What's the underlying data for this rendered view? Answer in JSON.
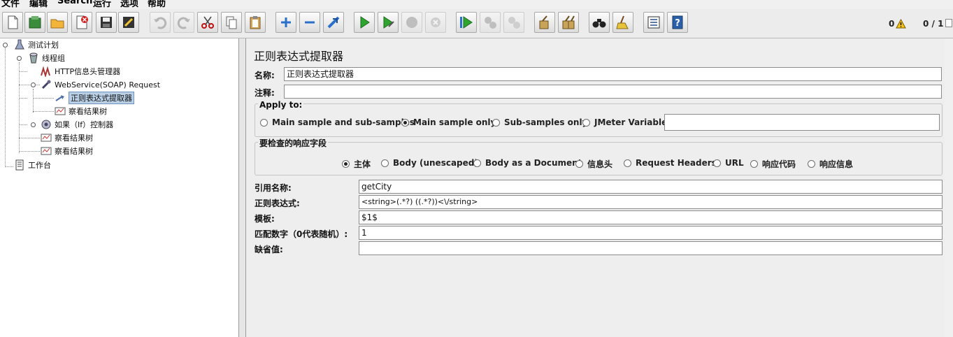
{
  "menu": [
    "文件",
    "编辑",
    "Search",
    "运行",
    "选项",
    "帮助"
  ],
  "status": {
    "warnings": "0",
    "threads": "0 / 1"
  },
  "toolbar": {
    "buttons": [
      "new-file-icon",
      "templates-icon",
      "open-icon",
      "close-icon",
      "save-icon",
      "save-as-icon",
      "undo-icon",
      "redo-icon",
      "cut-icon",
      "copy-icon",
      "paste-icon",
      "expand-icon",
      "collapse-icon",
      "toggle-icon",
      "start-icon",
      "start-no-pause-icon",
      "stop-icon",
      "shutdown-icon",
      "remote-start-icon",
      "remote-stop-icon",
      "remote-shutdown-icon",
      "clear-icon",
      "clear-all-icon",
      "search-icon",
      "reset-search-icon",
      "function-helper-icon",
      "help-icon"
    ]
  },
  "tree": {
    "items": [
      {
        "label": "测试计划"
      },
      {
        "label": "线程组"
      },
      {
        "label": "HTTP信息头管理器"
      },
      {
        "label": "WebService(SOAP) Request"
      },
      {
        "label": "正则表达式提取器"
      },
      {
        "label": "察看结果树"
      },
      {
        "label": "如果（If）控制器"
      },
      {
        "label": "察看结果树"
      },
      {
        "label": "察看结果树"
      },
      {
        "label": "工作台"
      }
    ]
  },
  "panel": {
    "title": "正则表达式提取器",
    "name_label": "名称:",
    "name_value": "正则表达式提取器",
    "comment_label": "注释:",
    "comment_value": "",
    "apply_to": {
      "title": "Apply to:",
      "options": [
        "Main sample and sub-samples",
        "Main sample only",
        "Sub-samples only",
        "JMeter Variable"
      ],
      "selected": 1,
      "variable_value": ""
    },
    "field_check": {
      "title": "要检查的响应字段",
      "options": [
        "主体",
        "Body (unescaped)",
        "Body as a Document",
        "信息头",
        "Request Headers",
        "URL",
        "响应代码",
        "响应信息"
      ],
      "selected": 0
    },
    "ref_name_label": "引用名称:",
    "ref_name_value": "getCity",
    "regex_label": "正则表达式:",
    "regex_value": "<string>(.*?) ((.*?))<\\/string>",
    "template_label": "模板:",
    "template_value": "$1$",
    "match_no_label": "匹配数字（0代表随机）:",
    "match_no_value": "1",
    "default_label": "缺省值:",
    "default_value": ""
  }
}
